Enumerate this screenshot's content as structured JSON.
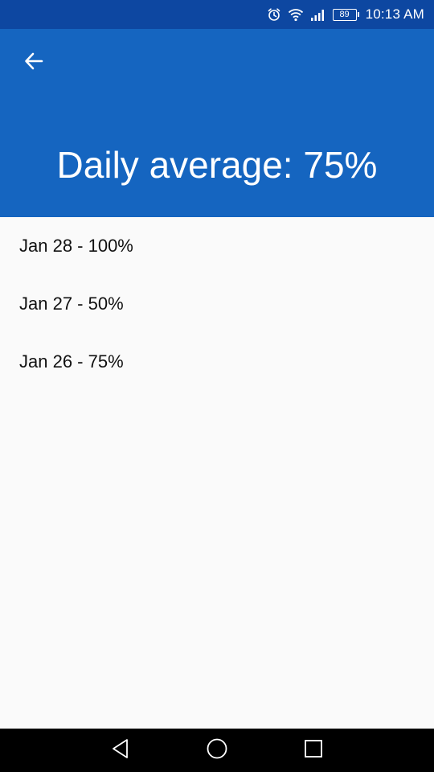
{
  "status_bar": {
    "battery": "89",
    "time": "10:13 AM",
    "icons": [
      "alarm-icon",
      "wifi-icon",
      "signal-icon",
      "battery-icon"
    ]
  },
  "app_bar": {
    "back_icon": "arrow-back-icon",
    "title": "Daily average: 75%"
  },
  "history": [
    "Jan 28 - 100%",
    "Jan 27 - 50%",
    "Jan 26 - 75%"
  ],
  "nav_bar": {
    "icons": [
      "back-triangle-icon",
      "home-circle-icon",
      "recents-square-icon"
    ]
  },
  "colors": {
    "status_bar": "#0d47a1",
    "app_bar": "#1565c0",
    "background": "#fafafa",
    "nav_bar": "#000000"
  }
}
